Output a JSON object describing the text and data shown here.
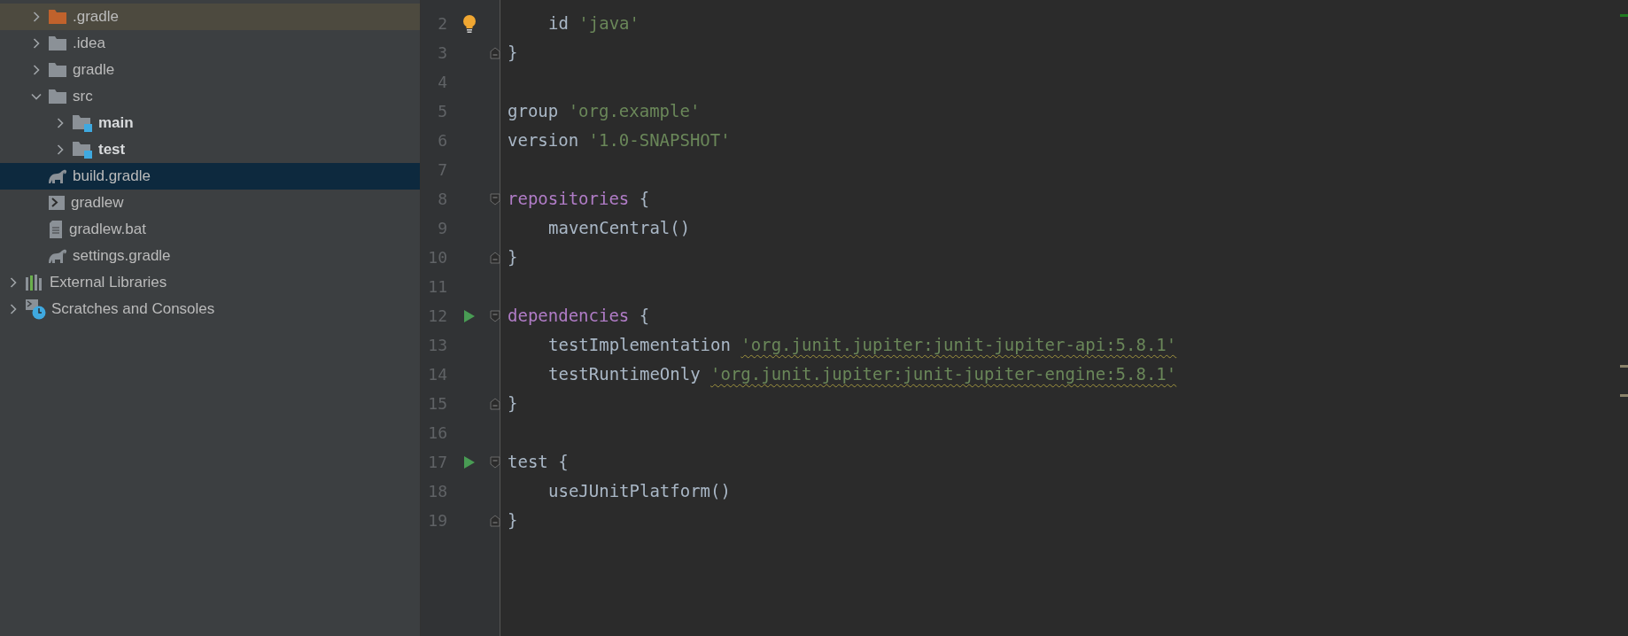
{
  "project_items": [
    {
      "label": ".gradle",
      "kind": "excluded-folder",
      "expanded": false,
      "selected": false
    },
    {
      "label": ".idea",
      "kind": "folder",
      "expanded": false,
      "selected": false
    },
    {
      "label": "gradle",
      "kind": "folder",
      "expanded": false,
      "selected": false
    },
    {
      "label": "src",
      "kind": "folder",
      "expanded": true,
      "selected": false,
      "children": [
        {
          "label": "main",
          "kind": "source-folder",
          "expanded": false,
          "selected": false
        },
        {
          "label": "test",
          "kind": "source-folder",
          "expanded": false,
          "selected": false
        }
      ]
    },
    {
      "label": "build.gradle",
      "kind": "gradle-file",
      "selected": true
    },
    {
      "label": "gradlew",
      "kind": "script-file",
      "selected": false
    },
    {
      "label": "gradlew.bat",
      "kind": "text-file",
      "selected": false
    },
    {
      "label": "settings.gradle",
      "kind": "gradle-file",
      "selected": false
    }
  ],
  "other_items": [
    {
      "label": "External Libraries",
      "kind": "libraries",
      "expanded": false,
      "selected": false
    },
    {
      "label": "Scratches and Consoles",
      "kind": "scratches",
      "expanded": false,
      "selected": false
    }
  ],
  "editor": {
    "lines": [
      {
        "number": "2",
        "bulb": true,
        "run": false,
        "fold_start": false,
        "fold_end": false,
        "indented": true,
        "tokens": [
          {
            "kind": "plain",
            "text": "id "
          },
          {
            "kind": "string",
            "text": "'java'"
          }
        ]
      },
      {
        "number": "3",
        "bulb": false,
        "run": false,
        "fold_start": false,
        "fold_end": true,
        "indented": false,
        "tokens": [
          {
            "kind": "plain",
            "text": "}"
          }
        ]
      },
      {
        "number": "4",
        "bulb": false,
        "run": false,
        "fold_start": false,
        "fold_end": false
      },
      {
        "number": "5",
        "bulb": false,
        "run": false,
        "fold_start": false,
        "fold_end": false,
        "indented": false,
        "tokens": [
          {
            "kind": "plain",
            "text": "group "
          },
          {
            "kind": "string",
            "text": "'org.example'"
          }
        ]
      },
      {
        "number": "6",
        "bulb": false,
        "run": false,
        "fold_start": false,
        "fold_end": false,
        "indented": false,
        "tokens": [
          {
            "kind": "plain",
            "text": "version "
          },
          {
            "kind": "string",
            "text": "'1.0-SNAPSHOT'"
          }
        ]
      },
      {
        "number": "7",
        "bulb": false,
        "run": false,
        "fold_start": false,
        "fold_end": false
      },
      {
        "number": "8",
        "bulb": false,
        "run": false,
        "fold_start": true,
        "fold_end": false,
        "indented": false,
        "tokens": [
          {
            "kind": "block",
            "text": "repositories"
          },
          {
            "kind": "plain",
            "text": " {"
          }
        ]
      },
      {
        "number": "9",
        "bulb": false,
        "run": false,
        "fold_start": false,
        "fold_end": false,
        "indented": true,
        "tokens": [
          {
            "kind": "plain",
            "text": "mavenCentral()"
          }
        ]
      },
      {
        "number": "10",
        "bulb": false,
        "run": false,
        "fold_start": false,
        "fold_end": true,
        "indented": false,
        "tokens": [
          {
            "kind": "plain",
            "text": "}"
          }
        ]
      },
      {
        "number": "11",
        "bulb": false,
        "run": false,
        "fold_start": false,
        "fold_end": false
      },
      {
        "number": "12",
        "bulb": false,
        "run": true,
        "fold_start": true,
        "fold_end": false,
        "indented": false,
        "tokens": [
          {
            "kind": "block",
            "text": "dependencies"
          },
          {
            "kind": "plain",
            "text": " {"
          }
        ]
      },
      {
        "number": "13",
        "bulb": false,
        "run": false,
        "fold_start": false,
        "fold_end": false,
        "indented": true,
        "tokens": [
          {
            "kind": "plain",
            "text": "testImplementation "
          },
          {
            "kind": "warning-string",
            "text": "'org.junit.jupiter:junit-jupiter-api:5.8.1'"
          }
        ]
      },
      {
        "number": "14",
        "bulb": false,
        "run": false,
        "fold_start": false,
        "fold_end": false,
        "indented": true,
        "tokens": [
          {
            "kind": "plain",
            "text": "testRuntimeOnly "
          },
          {
            "kind": "warning-string",
            "text": "'org.junit.jupiter:junit-jupiter-engine:5.8.1'"
          }
        ]
      },
      {
        "number": "15",
        "bulb": false,
        "run": false,
        "fold_start": false,
        "fold_end": true,
        "indented": false,
        "tokens": [
          {
            "kind": "plain",
            "text": "}"
          }
        ]
      },
      {
        "number": "16",
        "bulb": false,
        "run": false,
        "fold_start": false,
        "fold_end": false
      },
      {
        "number": "17",
        "bulb": false,
        "run": true,
        "fold_start": true,
        "fold_end": false,
        "indented": false,
        "tokens": [
          {
            "kind": "plain",
            "text": "test {"
          }
        ]
      },
      {
        "number": "18",
        "bulb": false,
        "run": false,
        "fold_start": false,
        "fold_end": false,
        "indented": true,
        "tokens": [
          {
            "kind": "plain",
            "text": "useJUnitPlatform()"
          }
        ]
      },
      {
        "number": "19",
        "bulb": false,
        "run": false,
        "fold_start": false,
        "fold_end": true,
        "indented": false,
        "tokens": [
          {
            "kind": "plain",
            "text": "}"
          }
        ]
      }
    ]
  }
}
